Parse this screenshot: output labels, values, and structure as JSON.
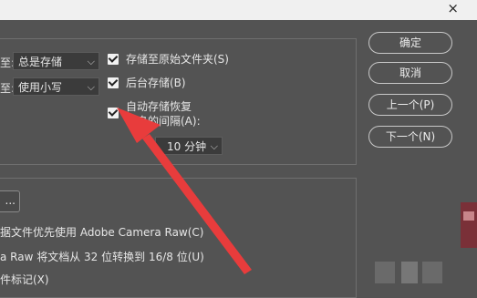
{
  "dialog": {
    "close_icon": "×"
  },
  "left_options": {
    "row1_label_fragment": "至:",
    "row1_select_value": "总是存储",
    "row2_label_fragment": "至:",
    "row2_select_value": "使用小写"
  },
  "checkboxes": [
    {
      "label": "存储至原始文件夹(S)",
      "checked": true
    },
    {
      "label": "后台存储(B)",
      "checked": true
    },
    {
      "label_line1": "自动存储恢复",
      "label_line2": "信息的间隔(A):",
      "checked": true
    }
  ],
  "interval_select_value": "10 分钟",
  "buttons": {
    "ok": "确定",
    "cancel": "取消",
    "prev": "上一个(P)",
    "next": "下一个(N)"
  },
  "lower_group": {
    "more_button": "...",
    "line1": "据文件优先使用 Adobe Camera Raw(C)",
    "line2": "a Raw 将文档从 32 位转换到 16/8 位(U)",
    "line3": "件标记(X)"
  }
}
